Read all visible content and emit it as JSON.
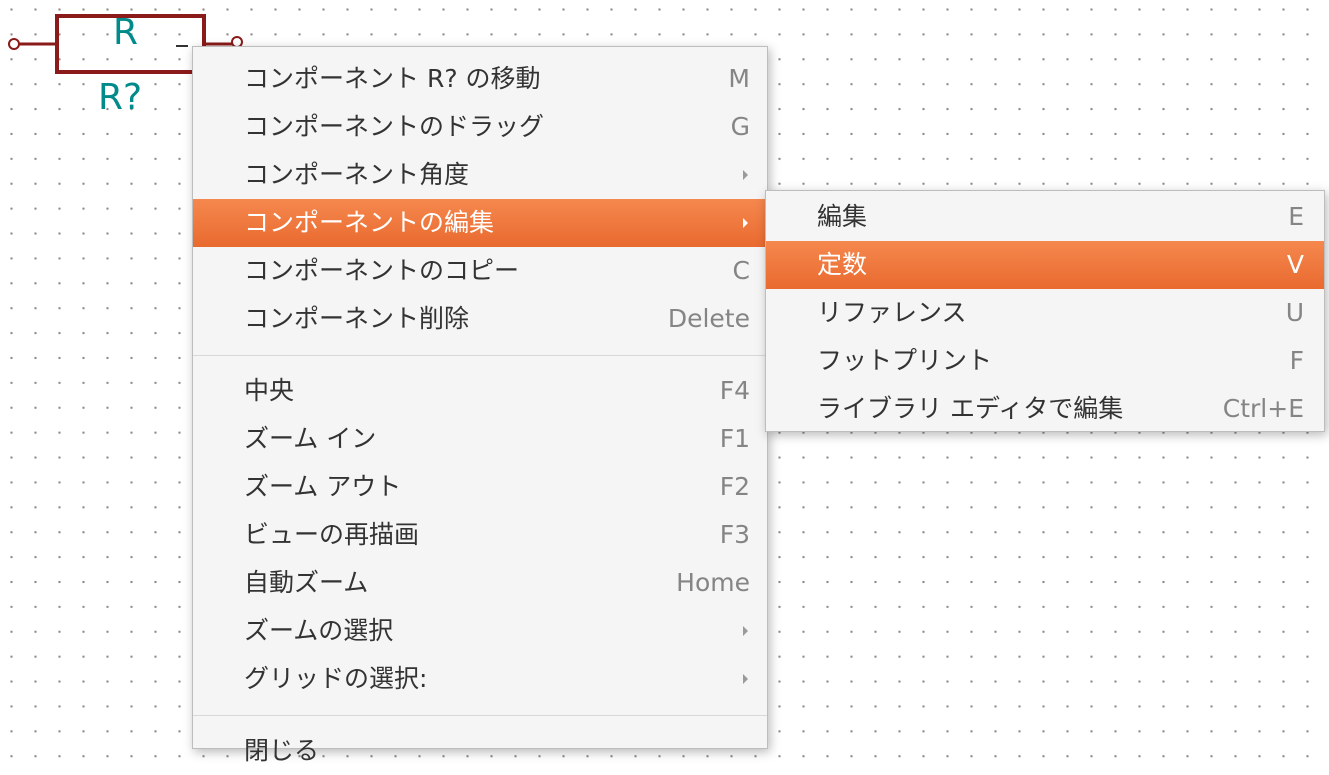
{
  "schematic": {
    "component_ref": "R",
    "component_value": "R?"
  },
  "context_menu": {
    "groups": [
      [
        {
          "label": "コンポーネント R? の移動",
          "shortcut": "M",
          "submenu": false
        },
        {
          "label": "コンポーネントのドラッグ",
          "shortcut": "G",
          "submenu": false
        },
        {
          "label": "コンポーネント角度",
          "shortcut": "",
          "submenu": true
        },
        {
          "label": "コンポーネントの編集",
          "shortcut": "",
          "submenu": true,
          "active": true
        },
        {
          "label": "コンポーネントのコピー",
          "shortcut": "C",
          "submenu": false
        },
        {
          "label": "コンポーネント削除",
          "shortcut": "Delete",
          "submenu": false
        }
      ],
      [
        {
          "label": "中央",
          "shortcut": "F4",
          "submenu": false
        },
        {
          "label": "ズーム イン",
          "shortcut": "F1",
          "submenu": false
        },
        {
          "label": "ズーム アウト",
          "shortcut": "F2",
          "submenu": false
        },
        {
          "label": "ビューの再描画",
          "shortcut": "F3",
          "submenu": false
        },
        {
          "label": "自動ズーム",
          "shortcut": "Home",
          "submenu": false
        },
        {
          "label": "ズームの選択",
          "shortcut": "",
          "submenu": true
        },
        {
          "label": "グリッドの選択:",
          "shortcut": "",
          "submenu": true
        }
      ],
      [
        {
          "label": "閉じる",
          "shortcut": "",
          "submenu": false
        }
      ]
    ]
  },
  "edit_submenu": {
    "items": [
      {
        "label": "編集",
        "shortcut": "E"
      },
      {
        "label": "定数",
        "shortcut": "V",
        "active": true
      },
      {
        "label": "リファレンス",
        "shortcut": "U"
      },
      {
        "label": "フットプリント",
        "shortcut": "F"
      },
      {
        "label": "ライブラリ エディタで編集",
        "shortcut": "Ctrl+E"
      }
    ]
  },
  "colors": {
    "component_body": "#8b1a1a",
    "component_text": "#008a8a",
    "menu_background": "#f5f5f5",
    "highlight": "#ed6e34",
    "grid_dot": "#8a8a8a"
  }
}
